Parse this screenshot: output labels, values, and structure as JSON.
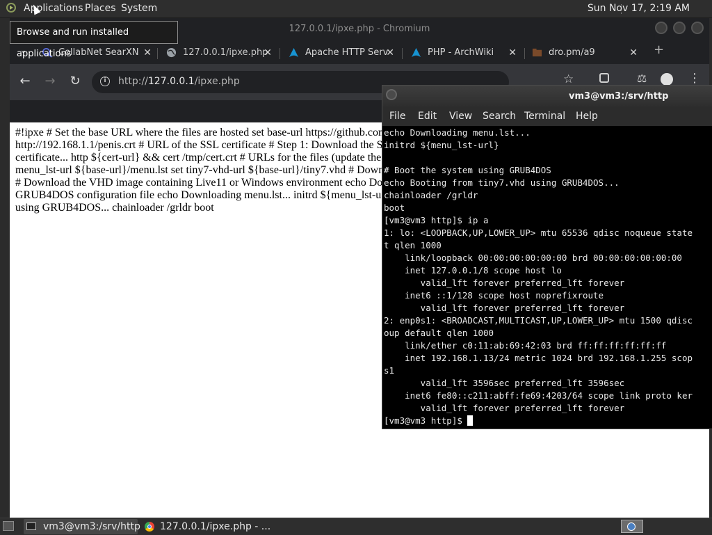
{
  "top_panel": {
    "menus": [
      "Applications",
      "Places",
      "System"
    ],
    "clock": "Sun Nov 17,  2:19 AM"
  },
  "tooltip": "Browse and run installed applications",
  "browser": {
    "window_title": "127.0.0.1/ipxe.php - Chromium",
    "tabs": [
      {
        "label": "CollabNet SearXN",
        "icon": "search-icon"
      },
      {
        "label": "127.0.0.1/ipxe.php",
        "icon": "globe-icon"
      },
      {
        "label": "Apache HTTP Serv",
        "icon": "arch-icon"
      },
      {
        "label": "PHP - ArchWiki",
        "icon": "arch-icon"
      },
      {
        "label": "dro.pm/a9",
        "icon": "folder-icon"
      }
    ],
    "url_prefix": "http://",
    "url_host": "127.0.0.1",
    "url_path": "/ipxe.php",
    "page_lines": [
      "#!ipxe # Set the base URL where the files are hosted set base-url https://github.com",
      "http://192.168.1.1/penis.crt # URL of the SSL certificate # Step 1: Download the S",
      "certificate... http ${cert-url} && cert /tmp/cert.crt # URLs for the files (update the",
      "menu_lst-url ${base-url}/menu.lst set tiny7-vhd-url ${base-url}/tiny7.vhd # Down",
      "# Download the VHD image containing Live11 or Windows environment echo Do",
      "GRUB4DOS configuration file echo Downloading menu.lst... initrd ${menu_lst-u",
      "using GRUB4DOS... chainloader /grldr boot"
    ]
  },
  "terminal": {
    "title": "vm3@vm3:/srv/http",
    "menus": [
      "File",
      "Edit",
      "View",
      "Search",
      "Terminal",
      "Help"
    ],
    "lines": [
      "echo Downloading menu.lst...",
      "initrd ${menu_lst-url}",
      "",
      "# Boot the system using GRUB4DOS",
      "echo Booting from tiny7.vhd using GRUB4DOS...",
      "chainloader /grldr",
      "boot",
      "[vm3@vm3 http]$ ip a",
      "1: lo: <LOOPBACK,UP,LOWER_UP> mtu 65536 qdisc noqueue state",
      "t qlen 1000",
      "    link/loopback 00:00:00:00:00:00 brd 00:00:00:00:00:00",
      "    inet 127.0.0.1/8 scope host lo",
      "       valid_lft forever preferred_lft forever",
      "    inet6 ::1/128 scope host noprefixroute",
      "       valid_lft forever preferred_lft forever",
      "2: enp0s1: <BROADCAST,MULTICAST,UP,LOWER_UP> mtu 1500 qdisc",
      "oup default qlen 1000",
      "    link/ether c0:11:ab:69:42:03 brd ff:ff:ff:ff:ff:ff",
      "    inet 192.168.1.13/24 metric 1024 brd 192.168.1.255 scop",
      "s1",
      "       valid_lft 3596sec preferred_lft 3596sec",
      "    inet6 fe80::c211:abff:fe69:4203/64 scope link proto ker",
      "       valid_lft forever preferred_lft forever"
    ],
    "prompt": "[vm3@vm3 http]$ "
  },
  "taskbar": {
    "items": [
      {
        "label": "vm3@vm3:/srv/http",
        "icon": "terminal-icon"
      },
      {
        "label": "127.0.0.1/ipxe.php - ...",
        "icon": "chromium-icon"
      }
    ]
  }
}
